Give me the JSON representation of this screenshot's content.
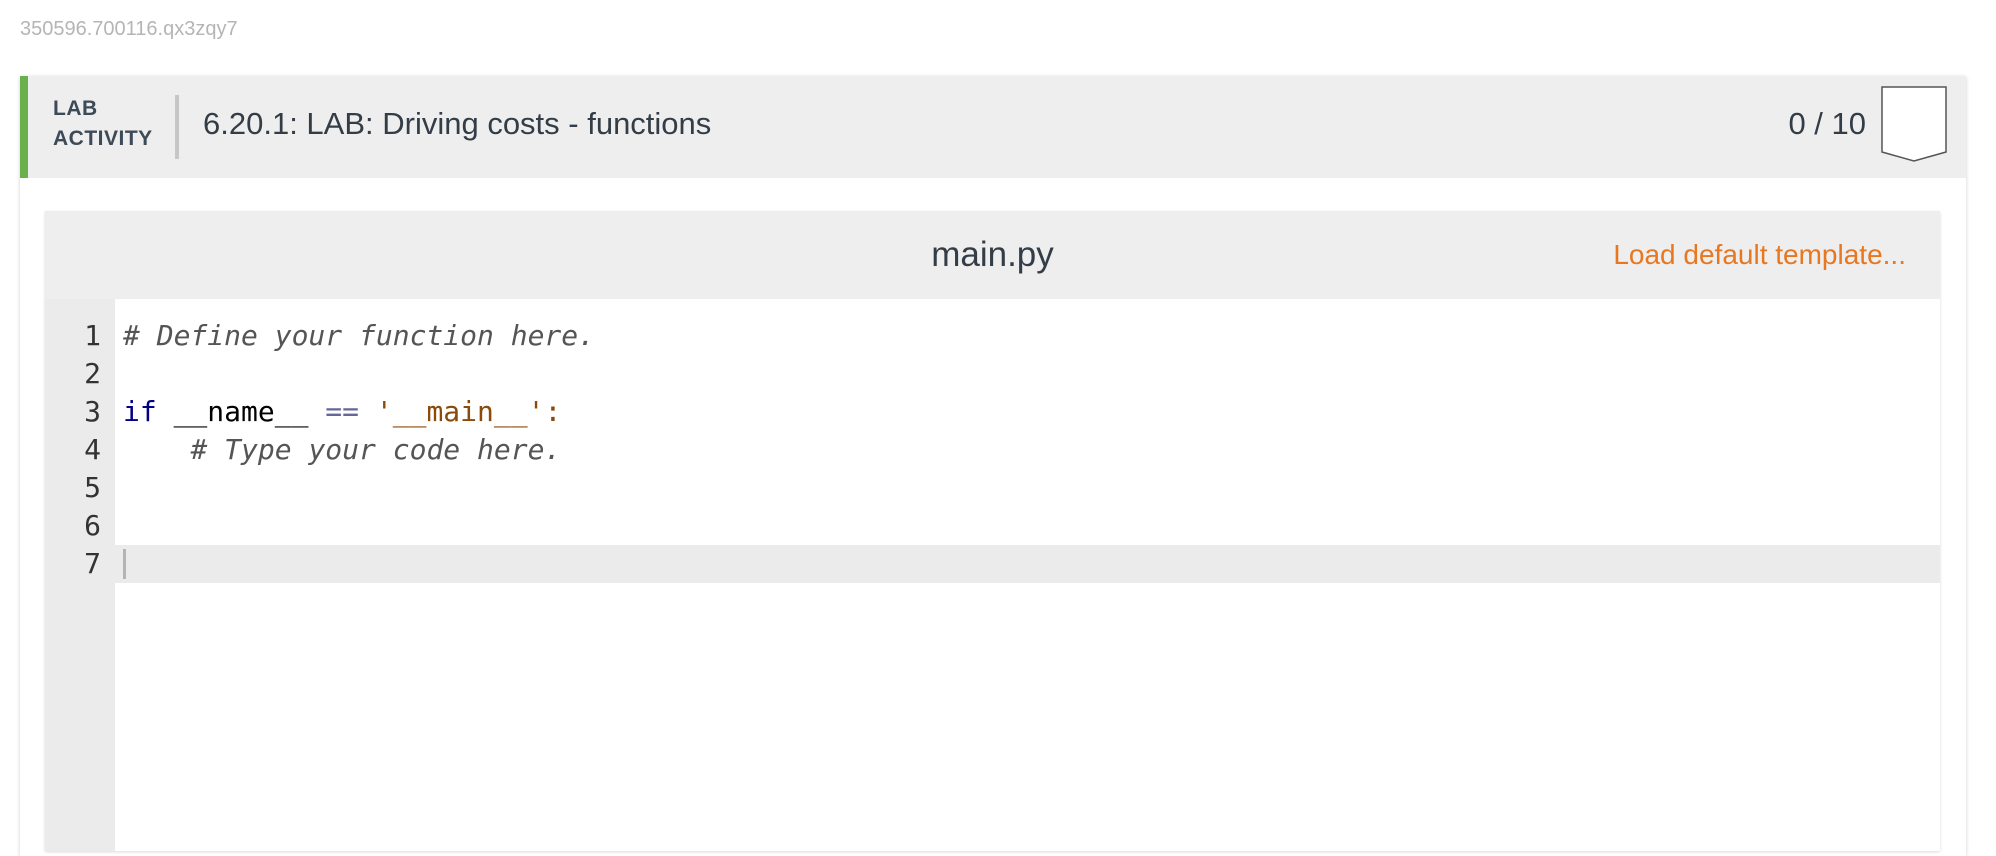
{
  "session_id": "350596.700116.qx3zqy7",
  "lab": {
    "kind_line1": "LAB",
    "kind_line2": "ACTIVITY",
    "title": "6.20.1: LAB: Driving costs - functions",
    "score": "0 / 10",
    "accent_color": "#6ab04c"
  },
  "editor": {
    "file_name": "main.py",
    "load_template_label": "Load default template...",
    "link_color": "#e87722",
    "lines": [
      {
        "num": "1",
        "tokens": [
          {
            "text": "# Define your function here.",
            "type": "comment"
          }
        ]
      },
      {
        "num": "2",
        "tokens": []
      },
      {
        "num": "3",
        "tokens": [
          {
            "text": "if",
            "type": "keyword"
          },
          {
            "text": " __name__ ",
            "type": "plain"
          },
          {
            "text": "==",
            "type": "op"
          },
          {
            "text": " ",
            "type": "plain"
          },
          {
            "text": "'__main__'",
            "type": "string"
          },
          {
            "text": ":",
            "type": "punct"
          }
        ]
      },
      {
        "num": "4",
        "tokens": [
          {
            "text": "    ",
            "type": "plain"
          },
          {
            "text": "# Type your code here.",
            "type": "comment"
          }
        ]
      },
      {
        "num": "5",
        "tokens": []
      },
      {
        "num": "6",
        "tokens": []
      },
      {
        "num": "7",
        "tokens": [],
        "active": true
      }
    ]
  }
}
